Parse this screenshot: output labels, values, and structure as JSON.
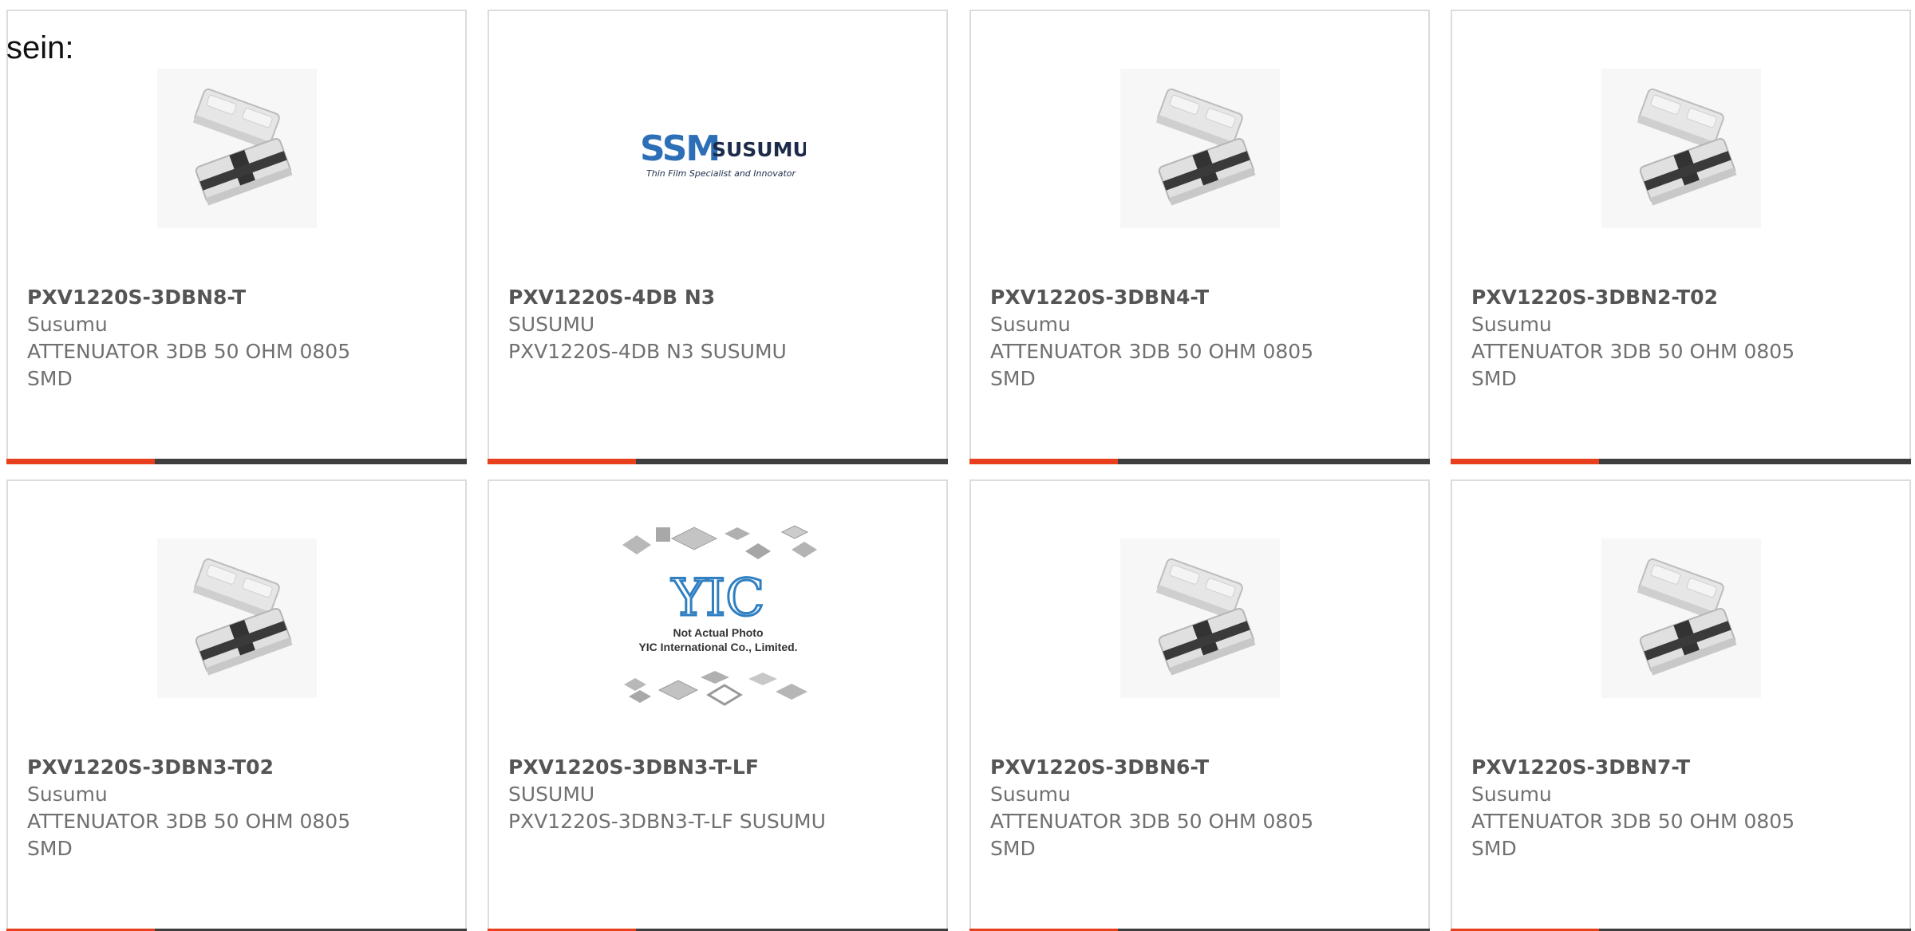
{
  "intro_text": "sein:",
  "colors": {
    "accent": "#e8401c",
    "bar": "#3e3e3e",
    "border": "#dcdcdc",
    "text": "#707070"
  },
  "products": [
    {
      "part": "PXV1220S-3DBN8-T",
      "maker": "Susumu",
      "desc": "ATTENUATOR 3DB 50 OHM 0805 SMD",
      "image": "attenuator-chip-photo"
    },
    {
      "part": "PXV1220S-4DB N3",
      "maker": "SUSUMU",
      "desc": "PXV1220S-4DB N3 SUSUMU",
      "image": "susumu-logo",
      "logo_text": {
        "mark": "SSM",
        "name": "SUSUMU",
        "tagline": "Thin Film Specialist and Innovator"
      }
    },
    {
      "part": "PXV1220S-3DBN4-T",
      "maker": "Susumu",
      "desc": "ATTENUATOR 3DB 50 OHM 0805 SMD",
      "image": "attenuator-chip-photo"
    },
    {
      "part": "PXV1220S-3DBN2-T02",
      "maker": "Susumu",
      "desc": "ATTENUATOR 3DB 50 OHM 0805 SMD",
      "image": "attenuator-chip-photo"
    },
    {
      "part": "PXV1220S-3DBN3-T02",
      "maker": "Susumu",
      "desc": "ATTENUATOR 3DB 50 OHM 0805 SMD",
      "image": "attenuator-chip-photo"
    },
    {
      "part": "PXV1220S-3DBN3-T-LF",
      "maker": "SUSUMU",
      "desc": "PXV1220S-3DBN3-T-LF SUSUMU",
      "image": "yic-placeholder",
      "placeholder_text": {
        "brand": "YIC",
        "line1": "Not Actual Photo",
        "line2": "YIC International Co., Limited."
      }
    },
    {
      "part": "PXV1220S-3DBN6-T",
      "maker": "Susumu",
      "desc": "ATTENUATOR 3DB 50 OHM 0805 SMD",
      "image": "attenuator-chip-photo"
    },
    {
      "part": "PXV1220S-3DBN7-T",
      "maker": "Susumu",
      "desc": "ATTENUATOR 3DB 50 OHM 0805 SMD",
      "image": "attenuator-chip-photo"
    }
  ]
}
